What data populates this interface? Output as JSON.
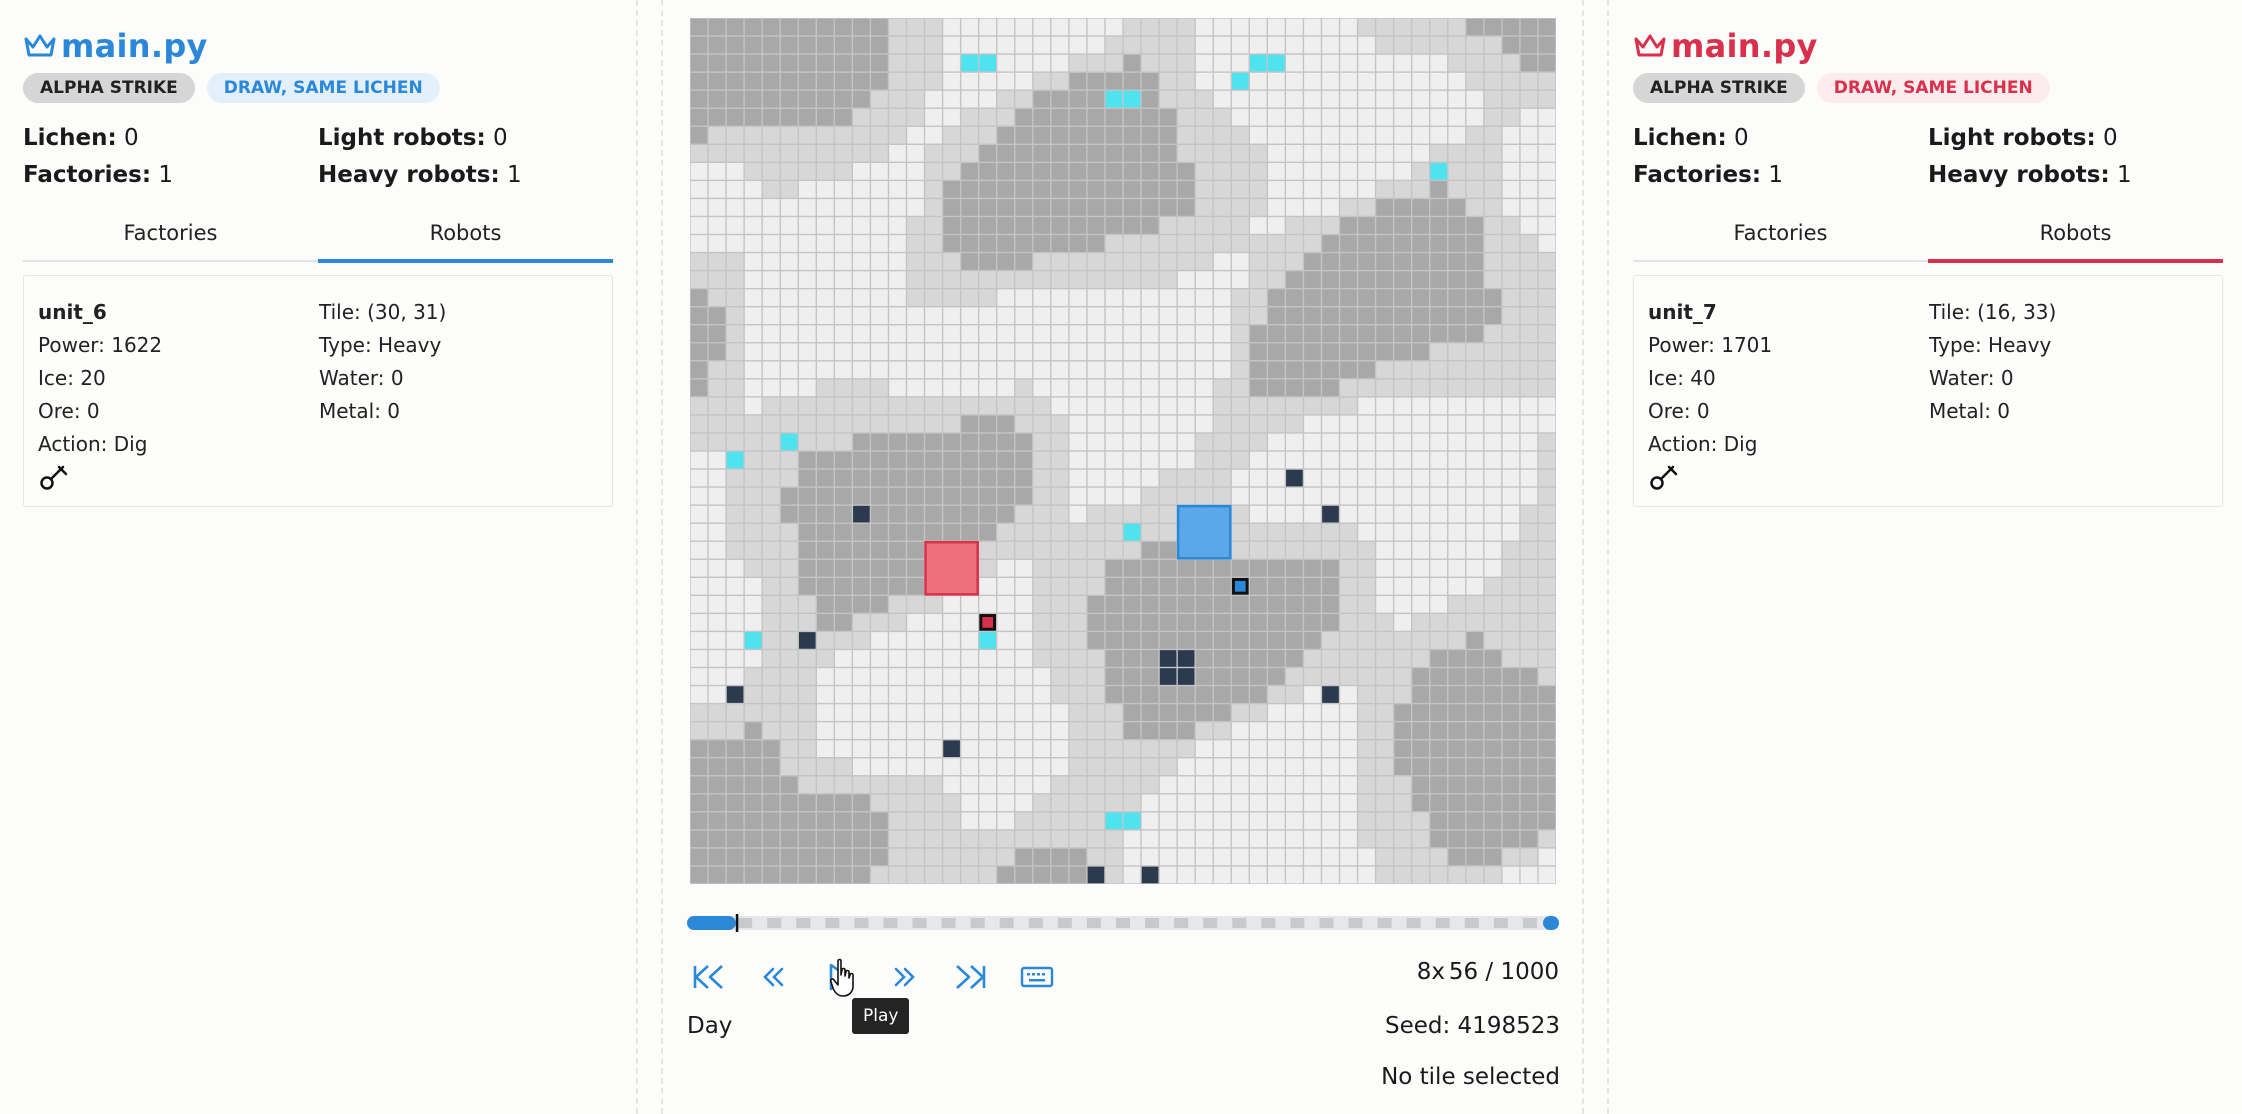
{
  "colors": {
    "player0": "#2b88d8",
    "player1": "#d9314b",
    "factory0_fill": "#5aa8e8",
    "factory1_fill": "#ee6f7d",
    "ice": "#4fe3f0",
    "ore": "#2b3a4f",
    "rubble_light": "#efefef",
    "rubble_mid": "#d7d7d7",
    "rubble_heavy": "#a8a8a8"
  },
  "players": [
    {
      "title": "main.py",
      "crown_icon": "crown-icon",
      "badge_team": "ALPHA STRIKE",
      "badge_result": "DRAW, SAME LICHEN",
      "stats": {
        "lichen_label": "Lichen:",
        "lichen_value": "0",
        "light_label": "Light robots:",
        "light_value": "0",
        "factories_label": "Factories:",
        "factories_value": "1",
        "heavy_label": "Heavy robots:",
        "heavy_value": "1"
      },
      "tabs": [
        "Factories",
        "Robots"
      ],
      "active_tab": "Robots",
      "unit": {
        "id": "unit_6",
        "power": "Power: 1622",
        "ice": "Ice: 20",
        "ore": "Ore: 0",
        "action": "Action: Dig",
        "tile": "Tile: (30, 31)",
        "type": "Type: Heavy",
        "water": "Water: 0",
        "metal": "Metal: 0",
        "action_icon": "shovel-icon"
      }
    },
    {
      "title": "main.py",
      "crown_icon": "crown-icon",
      "badge_team": "ALPHA STRIKE",
      "badge_result": "DRAW, SAME LICHEN",
      "stats": {
        "lichen_label": "Lichen:",
        "lichen_value": "0",
        "light_label": "Light robots:",
        "light_value": "0",
        "factories_label": "Factories:",
        "factories_value": "1",
        "heavy_label": "Heavy robots:",
        "heavy_value": "1"
      },
      "tabs": [
        "Factories",
        "Robots"
      ],
      "active_tab": "Robots",
      "unit": {
        "id": "unit_7",
        "power": "Power: 1701",
        "ice": "Ice: 40",
        "ore": "Ore: 0",
        "action": "Action: Dig",
        "tile": "Tile: (16, 33)",
        "type": "Type: Heavy",
        "water": "Water: 0",
        "metal": "Metal: 0",
        "action_icon": "shovel-icon"
      }
    }
  ],
  "board": {
    "size": 48,
    "ice_tiles": [
      [
        15,
        2
      ],
      [
        16,
        2
      ],
      [
        31,
        2
      ],
      [
        32,
        2
      ],
      [
        23,
        4
      ],
      [
        24,
        4
      ],
      [
        30,
        3
      ],
      [
        41,
        8
      ],
      [
        5,
        23
      ],
      [
        2,
        24
      ],
      [
        24,
        28
      ],
      [
        16,
        34
      ],
      [
        3,
        34
      ],
      [
        23,
        44
      ],
      [
        24,
        44
      ]
    ],
    "ore_tiles": [
      [
        9,
        27
      ],
      [
        33,
        25
      ],
      [
        35,
        27
      ],
      [
        6,
        34
      ],
      [
        26,
        35
      ],
      [
        27,
        35
      ],
      [
        26,
        36
      ],
      [
        27,
        36
      ],
      [
        2,
        37
      ],
      [
        35,
        37
      ],
      [
        14,
        40
      ],
      [
        22,
        47
      ],
      [
        25,
        47
      ]
    ],
    "factories": [
      {
        "player": 0,
        "tile": [
          28,
          28
        ]
      },
      {
        "player": 1,
        "tile": [
          14,
          30
        ]
      }
    ],
    "units": [
      {
        "player": 0,
        "tile": [
          30,
          31
        ]
      },
      {
        "player": 1,
        "tile": [
          16,
          33
        ]
      }
    ]
  },
  "playback": {
    "step": 56,
    "max_step": 1000,
    "step_text": "56 / 1000",
    "speed_text": "8x",
    "phase_text": "Day",
    "seed_text": "Seed: 4198523",
    "tile_status": "No tile selected",
    "tooltip": "Play",
    "button_icons": [
      "skip-back-icon",
      "rewind-icon",
      "play-icon",
      "fast-forward-icon",
      "skip-forward-icon",
      "keyboard-icon"
    ]
  }
}
